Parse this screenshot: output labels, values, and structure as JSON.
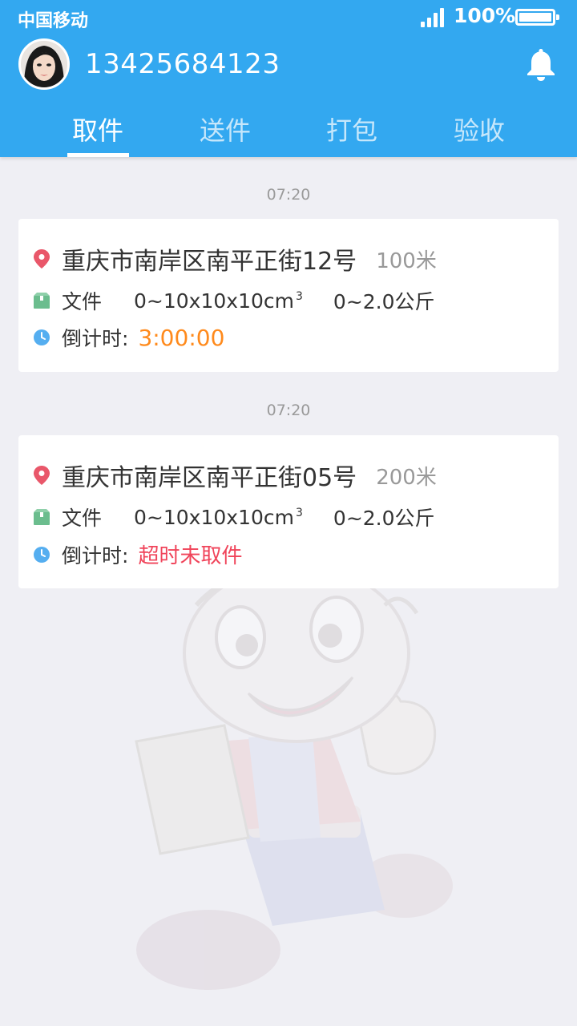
{
  "status_bar": {
    "carrier": "中国移动",
    "battery": "100%"
  },
  "header": {
    "phone": "13425684123"
  },
  "tabs": [
    {
      "label": "取件",
      "active": true
    },
    {
      "label": "送件",
      "active": false
    },
    {
      "label": "打包",
      "active": false
    },
    {
      "label": "验收",
      "active": false
    }
  ],
  "orders": [
    {
      "time": "07:20",
      "address": "重庆市南岸区南平正街12号",
      "distance": "100米",
      "type": "文件",
      "dimensions": "0~10x10x10cm",
      "dimension_unit_sup": "3",
      "weight": "0~2.0公斤",
      "countdown_label": "倒计时:",
      "countdown_value": "3:00:00",
      "countdown_color": "#ff8a1c"
    },
    {
      "time": "07:20",
      "address": "重庆市南岸区南平正街05号",
      "distance": "200米",
      "type": "文件",
      "dimensions": "0~10x10x10cm",
      "dimension_unit_sup": "3",
      "weight": "0~2.0公斤",
      "countdown_label": "倒计时:",
      "countdown_value": "超时未取件",
      "countdown_color": "#f0445a"
    }
  ],
  "colors": {
    "header": "#33a8f0",
    "location_icon": "#e9576a",
    "package_icon": "#6bbd8e",
    "clock_icon": "#55aef0"
  },
  "icons": [
    "signal-icon",
    "battery-icon",
    "bell-icon",
    "location-pin-icon",
    "package-icon",
    "clock-icon",
    "courier-mascot"
  ]
}
